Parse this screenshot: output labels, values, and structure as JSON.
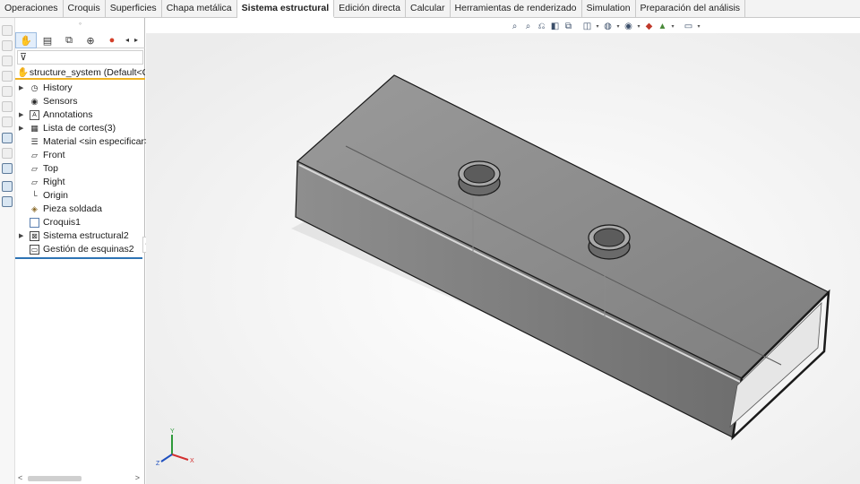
{
  "tabs": [
    {
      "label": "Operaciones",
      "active": false
    },
    {
      "label": "Croquis",
      "active": false
    },
    {
      "label": "Superficies",
      "active": false
    },
    {
      "label": "Chapa metálica",
      "active": false
    },
    {
      "label": "Sistema estructural",
      "active": true
    },
    {
      "label": "Edición directa",
      "active": false
    },
    {
      "label": "Calcular",
      "active": false
    },
    {
      "label": "Herramientas de renderizado",
      "active": false
    },
    {
      "label": "Simulation",
      "active": false
    },
    {
      "label": "Preparación del análisis",
      "active": false
    }
  ],
  "feature_tree": {
    "root_label": "structure_system  (Default<Cor",
    "items": [
      {
        "label": "History",
        "icon": "history-icon",
        "expandable": true
      },
      {
        "label": "Sensors",
        "icon": "sensors-icon",
        "expandable": false
      },
      {
        "label": "Annotations",
        "icon": "annotations-icon",
        "expandable": true
      },
      {
        "label": "Lista de cortes(3)",
        "icon": "cut-list-icon",
        "expandable": true
      },
      {
        "label": "Material <sin especificar>",
        "icon": "material-icon",
        "expandable": false
      },
      {
        "label": "Front",
        "icon": "plane-icon",
        "expandable": false
      },
      {
        "label": "Top",
        "icon": "plane-icon",
        "expandable": false
      },
      {
        "label": "Right",
        "icon": "plane-icon",
        "expandable": false
      },
      {
        "label": "Origin",
        "icon": "origin-icon",
        "expandable": false
      },
      {
        "label": "Pieza soldada",
        "icon": "weldment-icon",
        "expandable": false
      },
      {
        "label": "Croquis1",
        "icon": "sketch-icon",
        "expandable": false
      },
      {
        "label": "Sistema estructural2",
        "icon": "structure-system-icon",
        "expandable": true
      },
      {
        "label": "Gestión de esquinas2",
        "icon": "corner-management-icon",
        "expandable": false
      }
    ]
  },
  "view_toolbar": [
    "zoom-to-fit-icon",
    "zoom-area-icon",
    "previous-view-icon",
    "section-view-icon",
    "dynamic-annotation-icon",
    "view-orientation-icon",
    "display-style-icon",
    "hide-show-icon",
    "appearance-icon",
    "scene-icon",
    "monitor-icon"
  ],
  "triad": {
    "x": "X",
    "y": "Y",
    "z": "Z"
  },
  "colors": {
    "accent_orange": "#f0b323",
    "accent_blue": "#2e74b5",
    "model_gray": "#8a8a8a"
  }
}
